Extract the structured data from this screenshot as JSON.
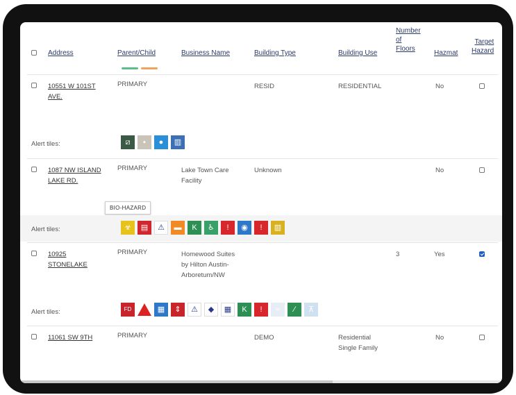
{
  "columns": {
    "address": "Address",
    "parent_child": "Parent/Child",
    "business_name": "Business Name",
    "building_type": "Building Type",
    "building_use": "Building Use",
    "floors_1": "Number",
    "floors_2": "of",
    "floors_3": "Floors",
    "hazmat": "Hazmat",
    "target_1": "Target",
    "target_2": "Hazard"
  },
  "colors": {
    "bar_green": "#5cbf87",
    "bar_orange": "#f0a35c"
  },
  "alert_label": "Alert tiles:",
  "tooltip": "BIO-HAZARD",
  "rows": [
    {
      "address_1": "10551 W 101ST",
      "address_2": "AVE.",
      "parent": "PRIMARY",
      "business_1": "",
      "business_2": "",
      "business_3": "",
      "type": "RESID",
      "use_1": "RESIDENTIAL",
      "use_2": "",
      "floors": "",
      "hazmat": "No",
      "target": false
    },
    {
      "address_1": "1087 NW ISLAND",
      "address_2": "LAKE RD.",
      "parent": "PRIMARY",
      "business_1": "Lake Town Care",
      "business_2": "Facility",
      "business_3": "",
      "type": "Unknown",
      "use_1": "",
      "use_2": "",
      "floors": "",
      "hazmat": "No",
      "target": false
    },
    {
      "address_1": "10925",
      "address_2": "STONELAKE",
      "parent": "PRIMARY",
      "business_1": "Homewood Suites",
      "business_2": "by Hilton Austin-",
      "business_3": "Arboretum/NW",
      "type": "",
      "use_1": "",
      "use_2": "",
      "floors": "3",
      "hazmat": "Yes",
      "target": true
    },
    {
      "address_1": "11061 SW 9TH",
      "address_2": "",
      "parent": "PRIMARY",
      "business_1": "",
      "business_2": "",
      "business_3": "",
      "type": "DEMO",
      "use_1": "Residential",
      "use_2": "Single Family",
      "floors": "",
      "hazmat": "No",
      "target": false
    }
  ],
  "tiles_1": [
    {
      "icon": "ladder-icon",
      "bg": "#3a5a46",
      "glyph": "⧄"
    },
    {
      "icon": "panel-icon",
      "bg": "#c9c3b8",
      "glyph": "▪"
    },
    {
      "icon": "water-icon",
      "bg": "#2a8fd6",
      "glyph": "●"
    },
    {
      "icon": "building-icon",
      "bg": "#3c6fb4",
      "glyph": "▥"
    }
  ],
  "tiles_2": [
    {
      "icon": "biohazard-icon",
      "bg": "#e6c21a",
      "glyph": "☣"
    },
    {
      "icon": "oxygen-icon",
      "bg": "#d0262e",
      "glyph": "▤"
    },
    {
      "icon": "hazard-g-icon",
      "bg": "#ffffff",
      "glyph": "⚠"
    },
    {
      "icon": "gate-icon",
      "bg": "#f08a24",
      "glyph": "▬"
    },
    {
      "icon": "knox-box-icon",
      "bg": "#2e8f55",
      "glyph": "K"
    },
    {
      "icon": "person-icon",
      "bg": "#3aa06a",
      "glyph": "♿"
    },
    {
      "icon": "warning-triangle-icon",
      "bg": "#d7262c",
      "glyph": "!"
    },
    {
      "icon": "standpipe-icon",
      "bg": "#2f78c8",
      "glyph": "◉"
    },
    {
      "icon": "warning-triangle-icon",
      "bg": "#d7262c",
      "glyph": "!"
    },
    {
      "icon": "fence-icon",
      "bg": "#d8b020",
      "glyph": "▥"
    }
  ],
  "tiles_3": [
    {
      "icon": "fdc-icon",
      "bg": "#c8242b",
      "glyph": "FD"
    },
    {
      "icon": "warning-triangle-icon",
      "bg": "triangle",
      "glyph": ""
    },
    {
      "icon": "grid-panel-icon",
      "bg": "#2f78c8",
      "glyph": "▦"
    },
    {
      "icon": "elevator-icon",
      "bg": "#c8242b",
      "glyph": "⇕"
    },
    {
      "icon": "hazard-g-icon",
      "bg": "#ffffff",
      "glyph": "⚠"
    },
    {
      "icon": "nfpa-diamond-icon",
      "bg": "#ffffff",
      "glyph": "◆"
    },
    {
      "icon": "building-grid-icon",
      "bg": "#ffffff",
      "glyph": "▦"
    },
    {
      "icon": "knox-box-icon",
      "bg": "#2e8f55",
      "glyph": "K"
    },
    {
      "icon": "warning-triangle-icon",
      "bg": "#d7262c",
      "glyph": "!"
    },
    {
      "icon": "sprinkler-icon",
      "bg": "#e6edf5",
      "glyph": "≈"
    },
    {
      "icon": "stairs-icon",
      "bg": "#2e8f55",
      "glyph": "∕"
    },
    {
      "icon": "drain-icon",
      "bg": "#cfe0f0",
      "glyph": "⊼"
    }
  ]
}
